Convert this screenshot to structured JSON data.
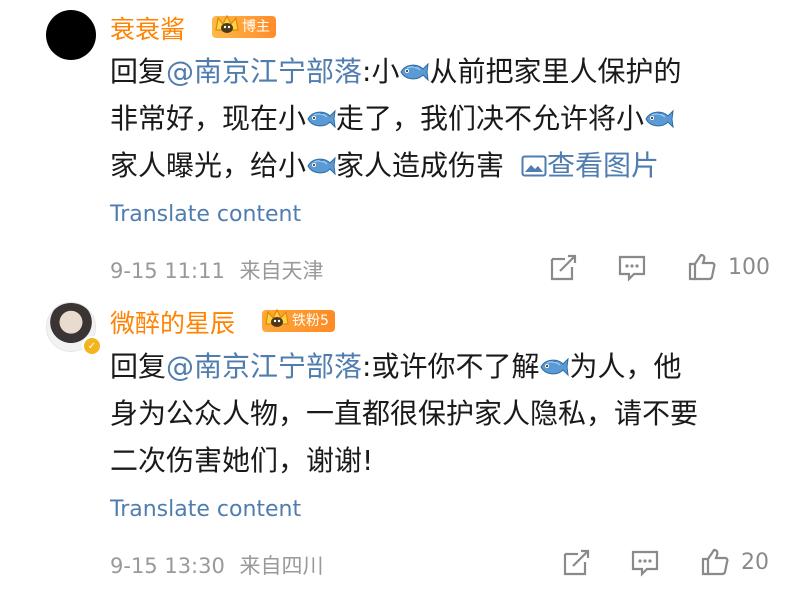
{
  "comments": [
    {
      "username": "衰衰酱",
      "badge": "博主",
      "text_parts": {
        "reply_prefix": "回复",
        "mention": "@南京江宁部落",
        "t1": ":小",
        "t2": "从前把家里人保护的",
        "t3": "非常好，现在小",
        "t4": "走了，我们决不允许将小",
        "t5": "家人曝光，给小",
        "t6": "家人造成伤害"
      },
      "view_image_link": "查看图片",
      "translate": "Translate content",
      "time": "9-15 11:11",
      "location": "来自天津",
      "likes": "100"
    },
    {
      "username": "微醉的星辰",
      "badge": "铁粉5",
      "text_parts": {
        "reply_prefix": "回复",
        "mention": "@南京江宁部落",
        "t1": ":或许你不了解",
        "t2": "为人，他",
        "t3": "身为公众人物，一直都很保护家人隐私，请不要",
        "t4": "二次伤害她们，谢谢!"
      },
      "translate": "Translate content",
      "time": "9-15 13:30",
      "location": "来自四川",
      "likes": "20"
    }
  ],
  "icons": {
    "fish": "fish-emoji-icon",
    "image": "image-icon",
    "repost": "repost-icon",
    "comment": "comment-icon",
    "like": "thumbs-up-icon",
    "pray": "pray-emoji-icon",
    "verified": "verified-icon",
    "crown": "crown-badge-icon"
  },
  "colors": {
    "username": "#ff8200",
    "link": "#507daf",
    "meta": "#999999",
    "badge": "#ff8c2a"
  }
}
